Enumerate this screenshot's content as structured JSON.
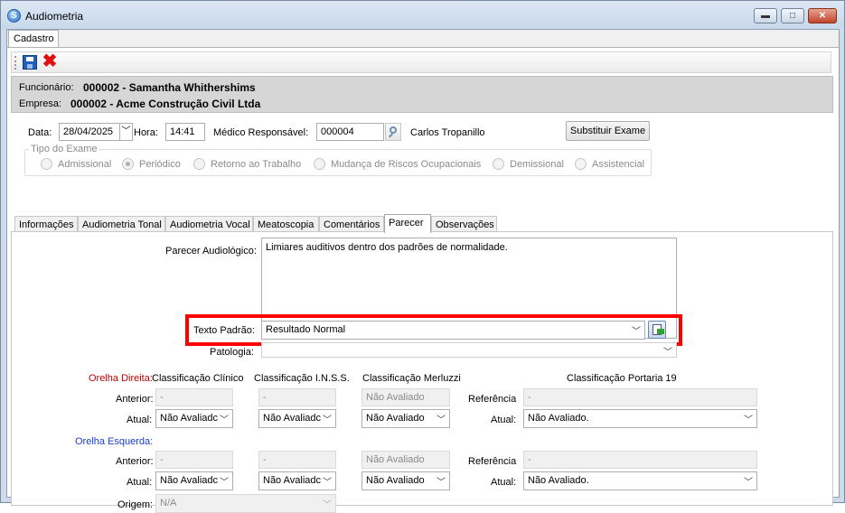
{
  "window": {
    "title": "Audiometria",
    "minimize_glyph": "▬",
    "maximize_glyph": "□",
    "close_glyph": "✕"
  },
  "top_tab": {
    "label": "Cadastro"
  },
  "header": {
    "funcionario_label": "Funcionário:",
    "funcionario_value": "000002 - Samantha Whithershims",
    "empresa_label": "Empresa:",
    "empresa_value": "000002 - Acme Construção Civil Ltda"
  },
  "form": {
    "data_label": "Data:",
    "data_value": "28/04/2025",
    "hora_label": "Hora:",
    "hora_value": "14:41",
    "medico_label": "Médico Responsável:",
    "medico_code": "000004",
    "medico_name": "Carlos Tropanillo",
    "substituir_button": "Substituir Exame"
  },
  "tipo_exame": {
    "legend": "Tipo do Exame",
    "options": [
      "Admissional",
      "Periódico",
      "Retorno ao Trabalho",
      "Mudança de Riscos Ocupacionais",
      "Demissional",
      "Assistencial"
    ],
    "selected": "Periódico"
  },
  "tabs": [
    "Informações",
    "Audiometria Tonal",
    "Audiometria Vocal",
    "Meatoscopia",
    "Comentários",
    "Parecer",
    "Observações"
  ],
  "active_tab": "Parecer",
  "parecer": {
    "parecer_label": "Parecer Audiológico:",
    "parecer_text": "Limiares auditivos dentro dos padrões de normalidade.",
    "texto_padrao_label": "Texto Padrão:",
    "texto_padrao_value": "Resultado Normal",
    "patologia_label": "Patologia:",
    "patologia_value": ""
  },
  "classificacao": {
    "orelha_direita_label": "Orelha Direita:",
    "orelha_esquerda_label": "Orelha Esquerda:",
    "col_clinico": "Classificação Clínico",
    "col_inss": "Classificação I.N.S.S.",
    "col_merluzzi": "Classificação Merluzzi",
    "col_portaria": "Classificação Portaria 19",
    "anterior_label": "Anterior:",
    "atual_label": "Atual:",
    "referencia_label": "Referência",
    "dash": "-",
    "nao_avaliado": "Não Avaliado",
    "nao_avaliado_truncated": "Não Avaliadc",
    "nao_avaliado_dot": "Não Avaliado.",
    "origem_label": "Origem:",
    "origem_value": "N/A"
  }
}
